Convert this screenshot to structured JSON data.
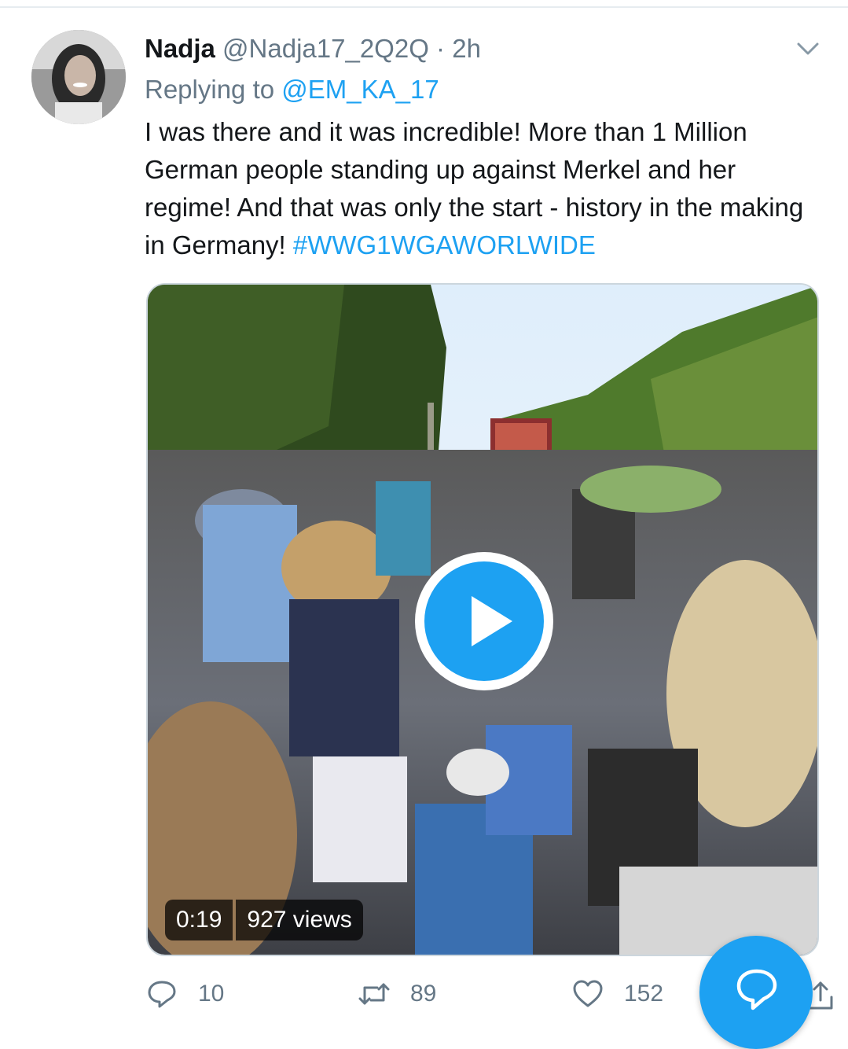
{
  "tweet": {
    "author_name": "Nadja",
    "author_handle": "@Nadja17_2Q2Q",
    "separator": "·",
    "time": "2h",
    "replying_prefix": "Replying to",
    "replying_to": "@EM_KA_17",
    "text": "I was there and it was incredible! More than 1 Million German people standing up against Merkel and her regime! And that was only the start - history in the making in Germany!",
    "hashtag": "#WWG1WGAWORLWIDE"
  },
  "video": {
    "duration": "0:19",
    "views": "927 views"
  },
  "actions": {
    "replies": "10",
    "retweets": "89",
    "likes": "152"
  },
  "icons": [
    "avatar-image",
    "chevron-down-icon",
    "play-icon",
    "reply-icon",
    "retweet-icon",
    "heart-icon",
    "share-icon",
    "compose-reply-icon"
  ],
  "colors": {
    "accent": "#1da1f2",
    "secondary_text": "#657786",
    "primary_text": "#14171a",
    "border": "#ccd6dd"
  }
}
